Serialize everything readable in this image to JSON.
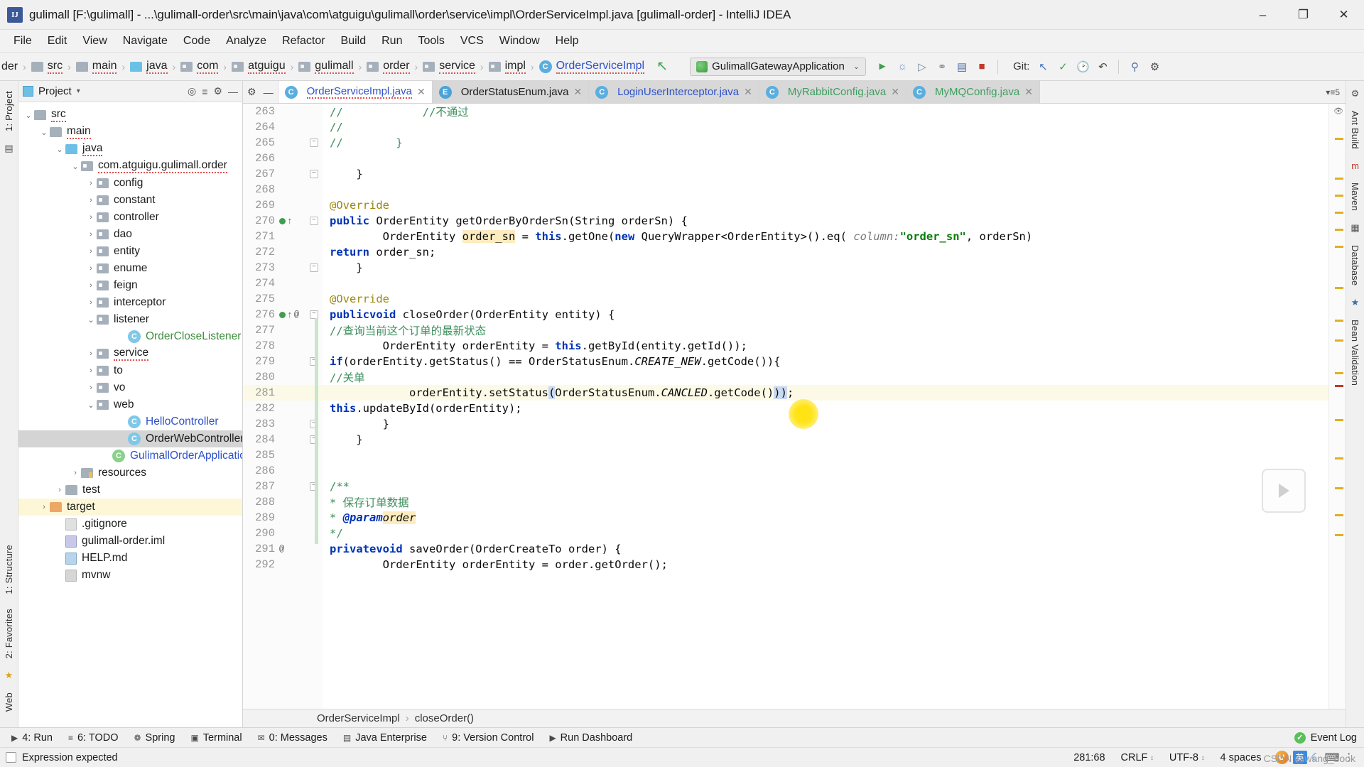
{
  "window": {
    "title": "gulimall [F:\\gulimall] - ...\\gulimall-order\\src\\main\\java\\com\\atguigu\\gulimall\\order\\service\\impl\\OrderServiceImpl.java [gulimall-order] - IntelliJ IDEA",
    "app_icon": "IJ",
    "minimize": "–",
    "maximize": "❐",
    "close": "✕"
  },
  "menu": [
    "File",
    "Edit",
    "View",
    "Navigate",
    "Code",
    "Analyze",
    "Refactor",
    "Build",
    "Run",
    "Tools",
    "VCS",
    "Window",
    "Help"
  ],
  "navbar": {
    "crumbs": [
      {
        "label": "der",
        "icon": "none",
        "type": "truncated"
      },
      {
        "label": "src",
        "icon": "folder",
        "type": "folder"
      },
      {
        "label": "main",
        "icon": "folder",
        "type": "folder"
      },
      {
        "label": "java",
        "icon": "folder-blue",
        "type": "source-folder"
      },
      {
        "label": "com",
        "icon": "package",
        "type": "package"
      },
      {
        "label": "atguigu",
        "icon": "package",
        "type": "package"
      },
      {
        "label": "gulimall",
        "icon": "package",
        "type": "package"
      },
      {
        "label": "order",
        "icon": "package",
        "type": "package"
      },
      {
        "label": "service",
        "icon": "package",
        "type": "package"
      },
      {
        "label": "impl",
        "icon": "package",
        "type": "package"
      },
      {
        "label": "OrderServiceImpl",
        "icon": "class",
        "type": "class"
      }
    ],
    "run_config": "GulimallGatewayApplication",
    "run_caret": "⌄",
    "git_label": "Git:",
    "toolbar_icons": [
      "run-icon",
      "debug-icon",
      "run-with-coverage-icon",
      "profile-icon",
      "stop-icon",
      "build-icon",
      "rollback-icon",
      "check-icon",
      "history-icon",
      "undo-icon",
      "search-everywhere-icon",
      "settings-icon"
    ],
    "back_arrow": "↖"
  },
  "project_panel": {
    "title": "Project",
    "caret": "▾",
    "locate_icon": "target-icon",
    "collapse_icon": "collapse-all-icon",
    "hide_icon": "—",
    "tree": [
      {
        "label": "src",
        "indent": 0,
        "arrow": "⌄",
        "icon": "folder",
        "selected": false,
        "spell": true
      },
      {
        "label": "main",
        "indent": 1,
        "arrow": "⌄",
        "icon": "folder",
        "selected": false,
        "spell": true
      },
      {
        "label": "java",
        "indent": 2,
        "arrow": "⌄",
        "icon": "folder-blue",
        "selected": false,
        "spell": true
      },
      {
        "label": "com.atguigu.gulimall.order",
        "indent": 3,
        "arrow": "⌄",
        "icon": "package",
        "selected": false,
        "spell": true
      },
      {
        "label": "config",
        "indent": 4,
        "arrow": "›",
        "icon": "package",
        "selected": false,
        "spell": false
      },
      {
        "label": "constant",
        "indent": 4,
        "arrow": "›",
        "icon": "package",
        "selected": false,
        "spell": false
      },
      {
        "label": "controller",
        "indent": 4,
        "arrow": "›",
        "icon": "package",
        "selected": false,
        "spell": false
      },
      {
        "label": "dao",
        "indent": 4,
        "arrow": "›",
        "icon": "package",
        "selected": false,
        "spell": false
      },
      {
        "label": "entity",
        "indent": 4,
        "arrow": "›",
        "icon": "package",
        "selected": false,
        "spell": false
      },
      {
        "label": "enume",
        "indent": 4,
        "arrow": "›",
        "icon": "package",
        "selected": false,
        "spell": false
      },
      {
        "label": "feign",
        "indent": 4,
        "arrow": "›",
        "icon": "package",
        "selected": false,
        "spell": false
      },
      {
        "label": "interceptor",
        "indent": 4,
        "arrow": "›",
        "icon": "package",
        "selected": false,
        "spell": false
      },
      {
        "label": "listener",
        "indent": 4,
        "arrow": "⌄",
        "icon": "package",
        "selected": false,
        "spell": false
      },
      {
        "label": "OrderCloseListener",
        "indent": 6,
        "arrow": "",
        "icon": "class-green",
        "selected": false,
        "spell": false
      },
      {
        "label": "service",
        "indent": 4,
        "arrow": "›",
        "icon": "package",
        "selected": false,
        "spell": true
      },
      {
        "label": "to",
        "indent": 4,
        "arrow": "›",
        "icon": "package",
        "selected": false,
        "spell": false
      },
      {
        "label": "vo",
        "indent": 4,
        "arrow": "›",
        "icon": "package",
        "selected": false,
        "spell": false
      },
      {
        "label": "web",
        "indent": 4,
        "arrow": "⌄",
        "icon": "package",
        "selected": false,
        "spell": false
      },
      {
        "label": "HelloController",
        "indent": 6,
        "arrow": "",
        "icon": "class-blue",
        "selected": false,
        "spell": false
      },
      {
        "label": "OrderWebController",
        "indent": 6,
        "arrow": "",
        "icon": "class",
        "selected": true,
        "spell": false
      },
      {
        "label": "GulimallOrderApplication",
        "indent": 5,
        "arrow": "",
        "icon": "spring-class",
        "selected": false,
        "spell": false
      },
      {
        "label": "resources",
        "indent": 3,
        "arrow": "›",
        "icon": "resources",
        "selected": false,
        "spell": false
      },
      {
        "label": "test",
        "indent": 2,
        "arrow": "›",
        "icon": "folder",
        "selected": false,
        "spell": false
      },
      {
        "label": "target",
        "indent": 1,
        "arrow": "›",
        "icon": "folder-orange",
        "selected": false,
        "spell": false,
        "highlight": true
      },
      {
        "label": ".gitignore",
        "indent": 2,
        "arrow": "",
        "icon": "file-git",
        "selected": false,
        "spell": false
      },
      {
        "label": "gulimall-order.iml",
        "indent": 2,
        "arrow": "",
        "icon": "file-iml",
        "selected": false,
        "spell": false
      },
      {
        "label": "HELP.md",
        "indent": 2,
        "arrow": "",
        "icon": "file-md",
        "selected": false,
        "spell": false
      },
      {
        "label": "mvnw",
        "indent": 2,
        "arrow": "",
        "icon": "file",
        "selected": false,
        "spell": false
      }
    ]
  },
  "editor": {
    "tabs": [
      {
        "label": "OrderServiceImpl.java",
        "icon": "C",
        "active": true,
        "close": "✕",
        "color": "blue"
      },
      {
        "label": "OrderStatusEnum.java",
        "icon": "E",
        "active": false,
        "close": "✕",
        "color": "dark"
      },
      {
        "label": "LoginUserInterceptor.java",
        "icon": "C",
        "active": false,
        "close": "✕",
        "color": "blue"
      },
      {
        "label": "MyRabbitConfig.java",
        "icon": "C",
        "active": false,
        "close": "✕",
        "color": "green"
      },
      {
        "label": "MyMQConfig.java",
        "icon": "C",
        "active": false,
        "close": "✕",
        "color": "green"
      }
    ],
    "tab_tools": {
      "settings": "⚙",
      "hide": "—"
    },
    "breadcrumb": {
      "class": "OrderServiceImpl",
      "sep": "›",
      "method": "closeOrder()"
    },
    "first_line_number": 263,
    "current_line": 281,
    "lines": [
      {
        "n": 263,
        "marks": [],
        "fold": false,
        "text_html": "<span class=\"cm\">//            //不通过</span>"
      },
      {
        "n": 264,
        "marks": [],
        "fold": false,
        "text_html": "<span class=\"cm\">//</span>"
      },
      {
        "n": 265,
        "marks": [],
        "fold": true,
        "text_html": "<span class=\"cm\">//        }</span>"
      },
      {
        "n": 266,
        "marks": [],
        "fold": false,
        "text_html": ""
      },
      {
        "n": 267,
        "marks": [],
        "fold": true,
        "text_html": "    }"
      },
      {
        "n": 268,
        "marks": [],
        "fold": false,
        "text_html": ""
      },
      {
        "n": 269,
        "marks": [],
        "fold": false,
        "text_html": "    <span class=\"ann\">@Override</span>"
      },
      {
        "n": 270,
        "marks": [
          "impl",
          "override"
        ],
        "fold": true,
        "text_html": "    <span class=\"kw\">public</span> OrderEntity getOrderByOrderSn(String orderSn) {"
      },
      {
        "n": 271,
        "marks": [],
        "fold": false,
        "text_html": "        OrderEntity <span class=\"hl\">order_sn</span> = <span class=\"kw\">this</span>.getOne(<span class=\"kw\">new</span> QueryWrapper&lt;OrderEntity&gt;().eq( <span class=\"pm\">column:</span> <span class=\"str\">\"order_sn\"</span>, orderSn)"
      },
      {
        "n": 272,
        "marks": [],
        "fold": false,
        "text_html": "        <span class=\"kw\">return</span> order_sn;"
      },
      {
        "n": 273,
        "marks": [],
        "fold": true,
        "text_html": "    }"
      },
      {
        "n": 274,
        "marks": [],
        "fold": false,
        "text_html": ""
      },
      {
        "n": 275,
        "marks": [],
        "fold": false,
        "text_html": "    <span class=\"ann\">@Override</span>"
      },
      {
        "n": 276,
        "marks": [
          "impl",
          "override",
          "at"
        ],
        "fold": true,
        "text_html": "    <span class=\"kw\">public</span> <span class=\"kw\">void</span> closeOrder(OrderEntity entity) {"
      },
      {
        "n": 277,
        "marks": [],
        "fold": false,
        "text_html": "        <span class=\"cm\">//查询当前这个订单的最新状态</span>"
      },
      {
        "n": 278,
        "marks": [],
        "fold": false,
        "text_html": "        OrderEntity orderEntity = <span class=\"kw\">this</span>.getById(entity.getId());"
      },
      {
        "n": 279,
        "marks": [],
        "fold": true,
        "text_html": "        <span class=\"kw\">if</span>(orderEntity.getStatus() == OrderStatusEnum.<span class=\"it\">CREATE_NEW</span>.getCode()){"
      },
      {
        "n": 280,
        "marks": [],
        "fold": false,
        "text_html": "            <span class=\"cm\">//关单</span>"
      },
      {
        "n": 281,
        "marks": [],
        "fold": false,
        "current": true,
        "text_html": "            orderEntity.setStatus<span class=\"brmatch\">(</span>OrderStatusEnum.<span class=\"it\">CANCLED</span>.getCode()<span class=\"brmatch\">)</span><span class=\"brmatch\">)</span>;"
      },
      {
        "n": 282,
        "marks": [],
        "fold": false,
        "text_html": "            <span class=\"kw\">this</span>.updateById(orderEntity);"
      },
      {
        "n": 283,
        "marks": [],
        "fold": true,
        "text_html": "        }"
      },
      {
        "n": 284,
        "marks": [],
        "fold": true,
        "text_html": "    }"
      },
      {
        "n": 285,
        "marks": [],
        "fold": false,
        "text_html": ""
      },
      {
        "n": 286,
        "marks": [],
        "fold": false,
        "text_html": ""
      },
      {
        "n": 287,
        "marks": [],
        "fold": true,
        "text_html": "    <span class=\"cm\">/**</span>"
      },
      {
        "n": 288,
        "marks": [],
        "fold": false,
        "text_html": "     <span class=\"cm\">* 保存订单数据</span>"
      },
      {
        "n": 289,
        "marks": [],
        "fold": false,
        "text_html": "     <span class=\"cm\">* </span><span class=\"doctag\">@param</span> <span class=\"hl\"><span class=\"it\">order</span></span>"
      },
      {
        "n": 290,
        "marks": [],
        "fold": false,
        "text_html": "     <span class=\"cm\">*/</span>"
      },
      {
        "n": 291,
        "marks": [
          "at"
        ],
        "fold": false,
        "text_html": "    <span class=\"kw\">private</span> <span class=\"kw\">void</span> saveOrder(OrderCreateTo order) {"
      },
      {
        "n": 292,
        "marks": [],
        "fold": false,
        "text_html": "        OrderEntity orderEntity = order.getOrder();"
      }
    ]
  },
  "left_rail": [
    {
      "label": "1: Project",
      "name": "sidebar-tab-project"
    },
    {
      "label": "1: Structure",
      "name": "sidebar-tab-structure"
    },
    {
      "label": "2: Favorites",
      "name": "sidebar-tab-favorites"
    },
    {
      "label": "Web",
      "name": "sidebar-tab-web"
    }
  ],
  "right_rail": [
    {
      "label": "Ant Build",
      "name": "sidebar-tab-ant-build"
    },
    {
      "label": "Maven",
      "name": "sidebar-tab-maven"
    },
    {
      "label": "Database",
      "name": "sidebar-tab-database"
    },
    {
      "label": "Bean Validation",
      "name": "sidebar-tab-bean-validation"
    }
  ],
  "bottom_toolwindows": [
    {
      "label": "4: Run",
      "icon": "▶",
      "name": "toolwindow-run"
    },
    {
      "label": "6: TODO",
      "icon": "≡",
      "name": "toolwindow-todo"
    },
    {
      "label": "Spring",
      "icon": "❁",
      "name": "toolwindow-spring"
    },
    {
      "label": "Terminal",
      "icon": "▣",
      "name": "toolwindow-terminal"
    },
    {
      "label": "0: Messages",
      "icon": "✉",
      "name": "toolwindow-messages"
    },
    {
      "label": "Java Enterprise",
      "icon": "▤",
      "name": "toolwindow-java-enterprise"
    },
    {
      "label": "9: Version Control",
      "icon": "⑂",
      "name": "toolwindow-version-control"
    },
    {
      "label": "Run Dashboard",
      "icon": "▶",
      "name": "toolwindow-run-dashboard"
    }
  ],
  "event_log": {
    "label": "Event Log",
    "icon": "✓"
  },
  "statusbar": {
    "message": "Expression expected",
    "position": "281:68",
    "line_separator": "CRLF",
    "encoding": "UTF-8",
    "indent": "4 spaces",
    "caret": "⌄",
    "ime_lang": "英",
    "watermark": "CSDN @wang_book"
  }
}
